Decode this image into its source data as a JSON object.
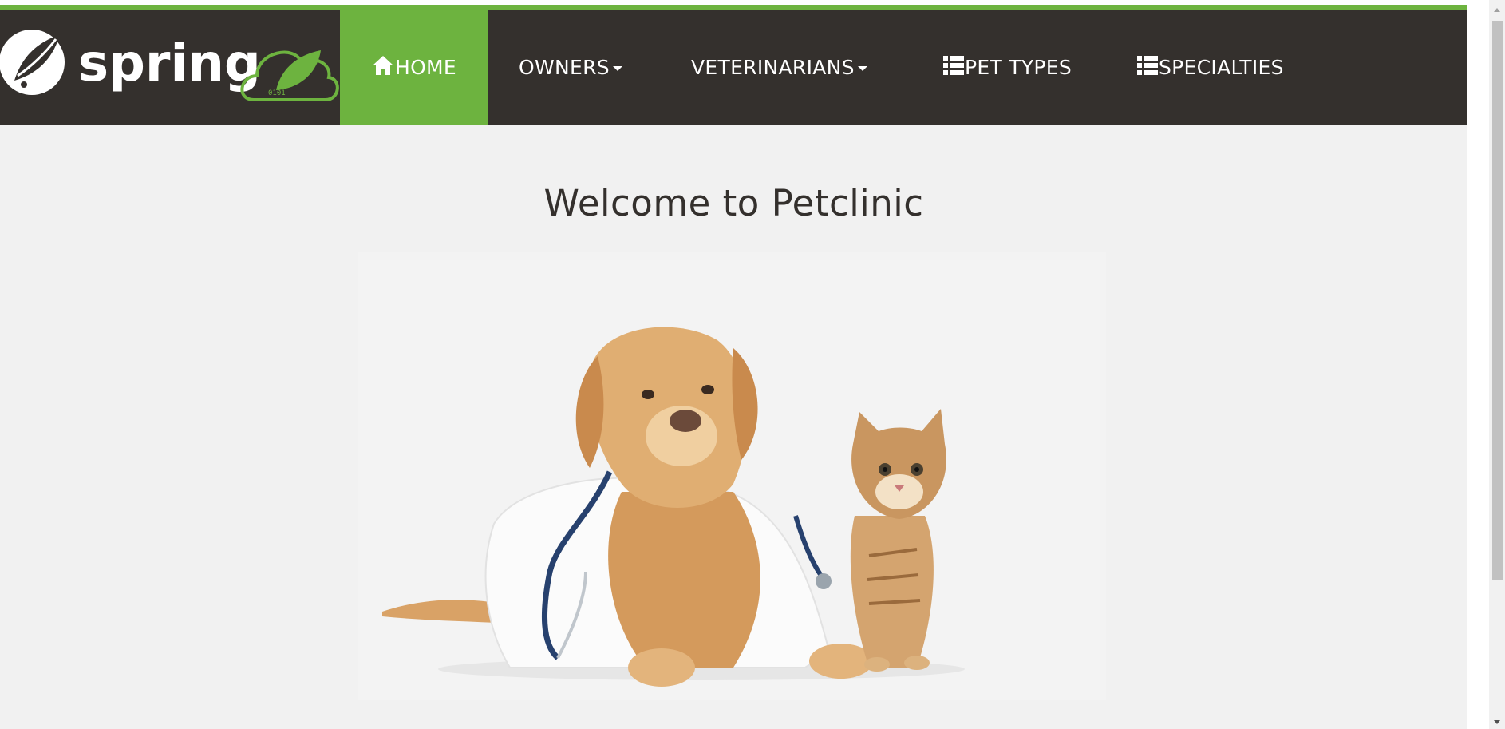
{
  "nav": {
    "brand": "spring",
    "items": [
      {
        "label": "HOME",
        "icon": "home-icon",
        "active": true
      },
      {
        "label": "OWNERS",
        "icon": "",
        "dropdown": true
      },
      {
        "label": "VETERINARIANS",
        "icon": "",
        "dropdown": true
      },
      {
        "label": "PET TYPES",
        "icon": "list-icon"
      },
      {
        "label": "SPECIALTIES",
        "icon": "list-icon"
      }
    ]
  },
  "main": {
    "title": "Welcome to Petclinic"
  },
  "colors": {
    "brand_green": "#6db33f",
    "nav_dark": "#34302d",
    "page_bg": "#f1f1f1"
  }
}
